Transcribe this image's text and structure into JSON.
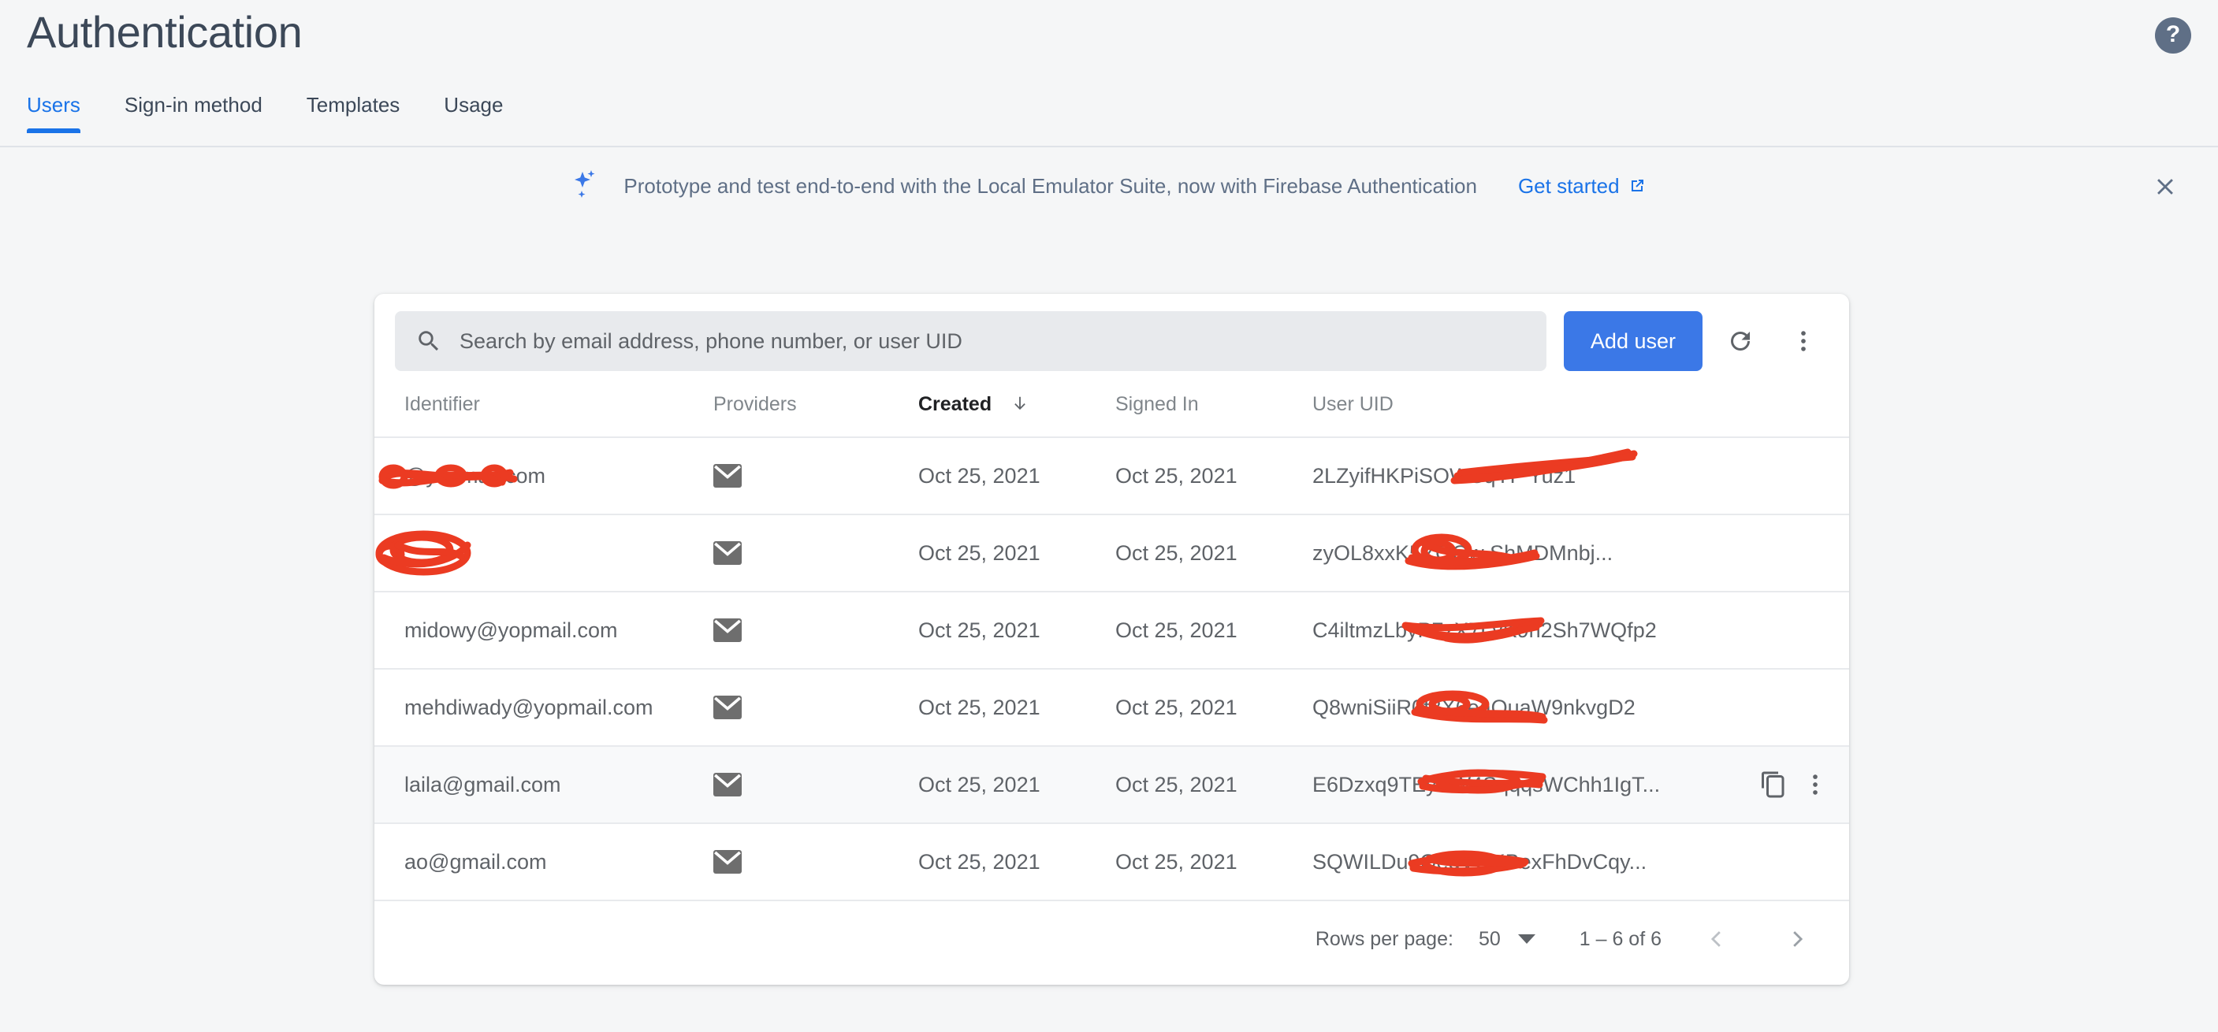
{
  "header": {
    "title": "Authentication",
    "help_icon": "help-question-icon",
    "help_glyph": "?"
  },
  "tabs": [
    {
      "label": "Users",
      "active": true
    },
    {
      "label": "Sign-in method",
      "active": false
    },
    {
      "label": "Templates",
      "active": false
    },
    {
      "label": "Usage",
      "active": false
    }
  ],
  "banner": {
    "icon": "sparkle-icon",
    "text": "Prototype and test end-to-end with the Local Emulator Suite, now with Firebase Authentication",
    "link_label": "Get started",
    "link_icon": "external-link-icon",
    "close_icon": "close-icon"
  },
  "toolbar": {
    "search_placeholder": "Search by email address, phone number, or user UID",
    "search_value": "",
    "search_icon": "search-icon",
    "add_user_label": "Add user",
    "refresh_icon": "refresh-icon",
    "more_icon": "more-vert-icon"
  },
  "table": {
    "columns": [
      {
        "label": "Identifier",
        "sorted": false
      },
      {
        "label": "Providers",
        "sorted": false
      },
      {
        "label": "Created",
        "sorted": true,
        "sort_dir": "desc"
      },
      {
        "label": "Signed In",
        "sorted": false
      },
      {
        "label": "User UID",
        "sorted": false
      }
    ],
    "rows": [
      {
        "identifier": "@yopmail.com",
        "identifier_redacted": true,
        "provider_icon": "email-icon",
        "created": "Oct 25, 2021",
        "signed_in": "Oct 25, 2021",
        "uid": "2LZyifHKPiSOWSqYF            Yuz1",
        "uid_redacted": true,
        "hovered": false
      },
      {
        "identifier": "",
        "identifier_redacted": true,
        "provider_icon": "email-icon",
        "created": "Oct 25, 2021",
        "signed_in": "Oct 25, 2021",
        "uid": "zyOL8xxK5YQGw        ShMDMnbj...",
        "uid_redacted": true,
        "hovered": false
      },
      {
        "identifier": "midowy@yopmail.com",
        "identifier_redacted": false,
        "provider_icon": "email-icon",
        "created": "Oct 25, 2021",
        "signed_in": "Oct 25, 2021",
        "uid": "C4iltmzLbyP7zX7LvK9h2Sh7WQfp2",
        "uid_redacted": true,
        "hovered": false
      },
      {
        "identifier": "mehdiwady@yopmail.com",
        "identifier_redacted": false,
        "provider_icon": "email-icon",
        "created": "Oct 25, 2021",
        "signed_in": "Oct 25, 2021",
        "uid": "Q8wniSiiR0f3X6eaQuaW9nkvgD2",
        "uid_redacted": true,
        "hovered": false
      },
      {
        "identifier": "laila@gmail.com",
        "identifier_redacted": false,
        "provider_icon": "email-icon",
        "created": "Oct 25, 2021",
        "signed_in": "Oct 25, 2021",
        "uid": "E6Dzxq9TEySW4SqqqsWChh1IgT...",
        "uid_redacted": true,
        "hovered": true,
        "copy_icon": "copy-icon",
        "more_icon": "more-vert-icon"
      },
      {
        "identifier": "ao@gmail.com",
        "identifier_redacted": false,
        "provider_icon": "email-icon",
        "created": "Oct 25, 2021",
        "signed_in": "Oct 25, 2021",
        "uid": "SQWILDu9OedVGKBexFhDvCqy...",
        "uid_redacted": true,
        "hovered": false
      }
    ]
  },
  "paginator": {
    "rows_per_page_label": "Rows per page:",
    "rows_per_page_value": "50",
    "range_label": "1 – 6 of 6",
    "prev_icon": "chevron-left-icon",
    "next_icon": "chevron-right-icon"
  },
  "colors": {
    "accent_blue": "#1a73e8",
    "button_blue": "#3b78e7",
    "title_slate": "#3c4858",
    "text_grey": "#5f6368",
    "muted_grey": "#80868b",
    "redaction_red": "#eb3b22",
    "page_bg": "#f5f6f7"
  }
}
